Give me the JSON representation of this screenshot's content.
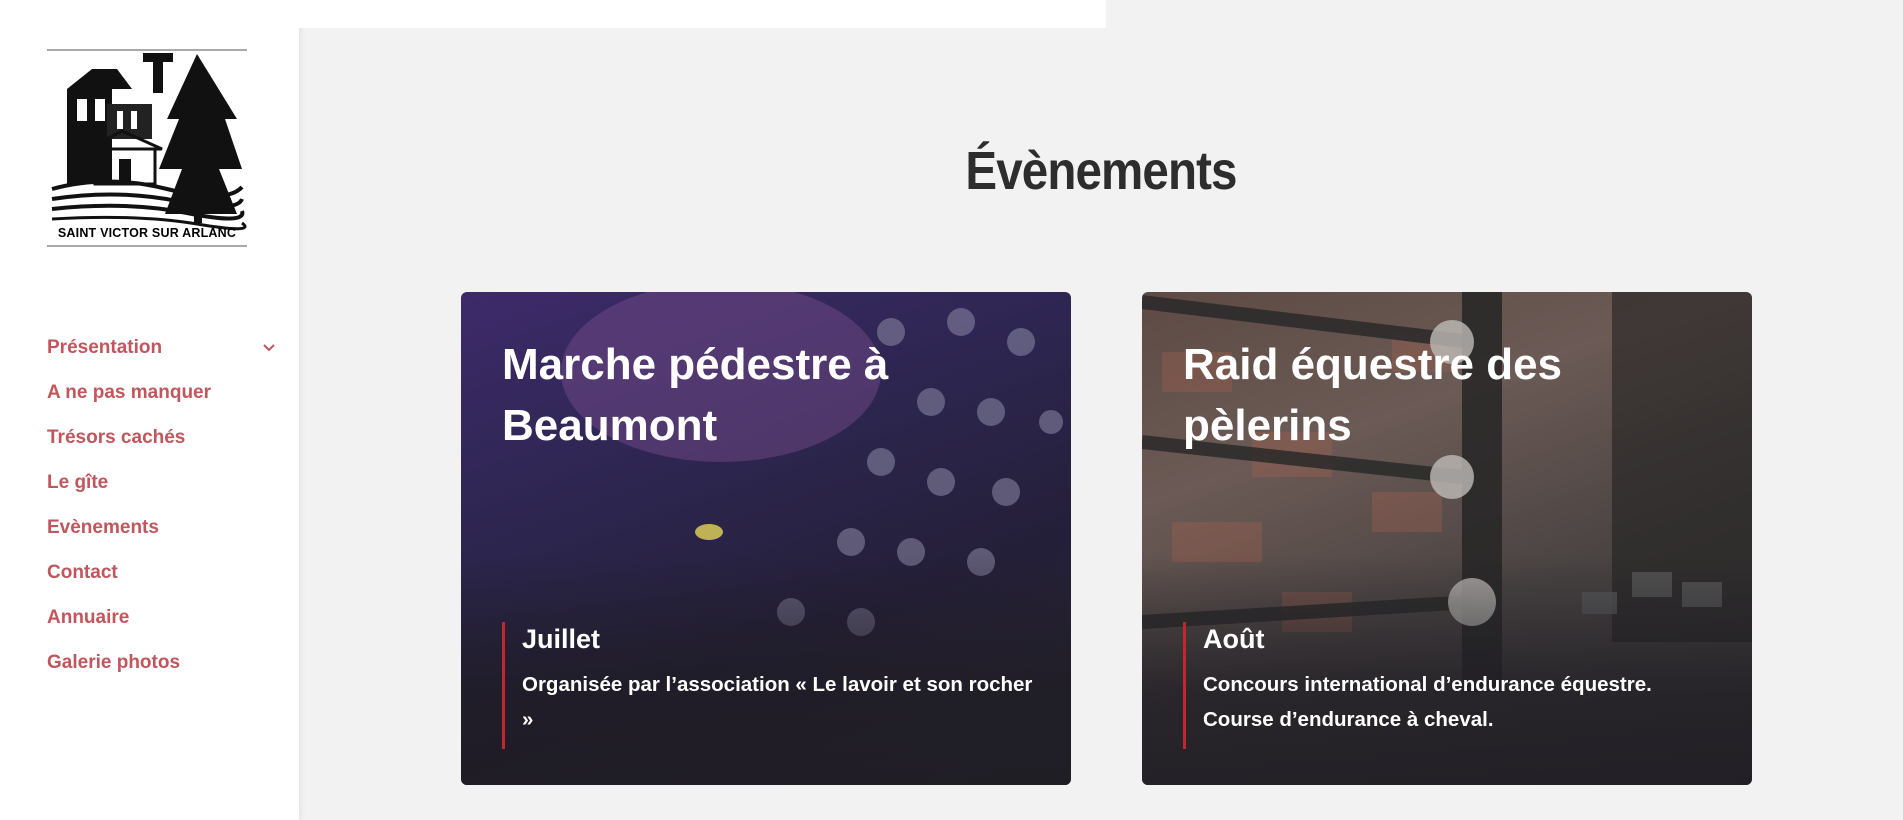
{
  "logo": {
    "text": "SAINT VICTOR SUR ARLANC"
  },
  "nav": {
    "items": [
      {
        "label": "Présentation",
        "has_submenu": true
      },
      {
        "label": "A ne pas manquer"
      },
      {
        "label": "Trésors cachés"
      },
      {
        "label": "Le gîte"
      },
      {
        "label": "Evènements"
      },
      {
        "label": "Contact"
      },
      {
        "label": "Annuaire"
      },
      {
        "label": "Galerie photos"
      }
    ]
  },
  "main": {
    "title": "Évènements",
    "events": [
      {
        "title": "Marche pédestre à Beaumont",
        "month": "Juillet",
        "description": "Organisée par l’association « Le lavoir et son rocher »"
      },
      {
        "title": "Raid équestre des pèlerins",
        "month": "Août",
        "description": "Concours international d’endurance équestre. Course d’endurance à cheval."
      }
    ]
  },
  "colors": {
    "accent": "#c2565d",
    "card_border": "#c0282e",
    "title": "#2d2d2d",
    "background": "#f2f2f2"
  }
}
